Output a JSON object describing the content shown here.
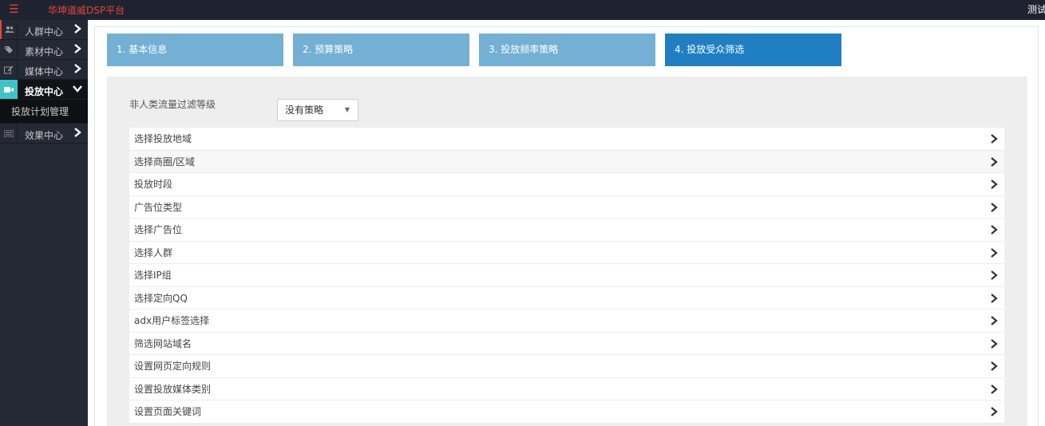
{
  "header": {
    "menu_icon": "hamburger-icon",
    "brand": "华坤道威DSP平台",
    "user": "测试"
  },
  "sidebar": {
    "items": [
      {
        "label": "人群中心",
        "icon": "users-icon"
      },
      {
        "label": "素材中心",
        "icon": "tag-icon"
      },
      {
        "label": "媒体中心",
        "icon": "edit-icon"
      },
      {
        "label": "投放中心",
        "icon": "video-camera-icon"
      },
      {
        "label": "效果中心",
        "icon": "list-icon"
      }
    ],
    "sub_item": "投放计划管理"
  },
  "steps": [
    {
      "label": "1. 基本信息"
    },
    {
      "label": "2. 预算策略"
    },
    {
      "label": "3. 投放频率策略"
    },
    {
      "label": "4. 投放受众筛选"
    }
  ],
  "filter": {
    "label": "非人类流量过滤等级",
    "value": "没有策略"
  },
  "options": [
    "选择投放地域",
    "选择商圈/区域",
    "投放时段",
    "广告位类型",
    "选择广告位",
    "选择人群",
    "选择IP组",
    "选择定向QQ",
    "adx用户标签选择",
    "筛选网站域名",
    "设置网页定向规则",
    "设置投放媒体类别",
    "设置页面关键词"
  ],
  "colors": {
    "brand": "#e4473a",
    "topbar": "#1f2331",
    "sidebar": "#252935",
    "active_icon": "#3ec3c9",
    "step": "#73b0d4",
    "step_active": "#1f7fc2"
  }
}
